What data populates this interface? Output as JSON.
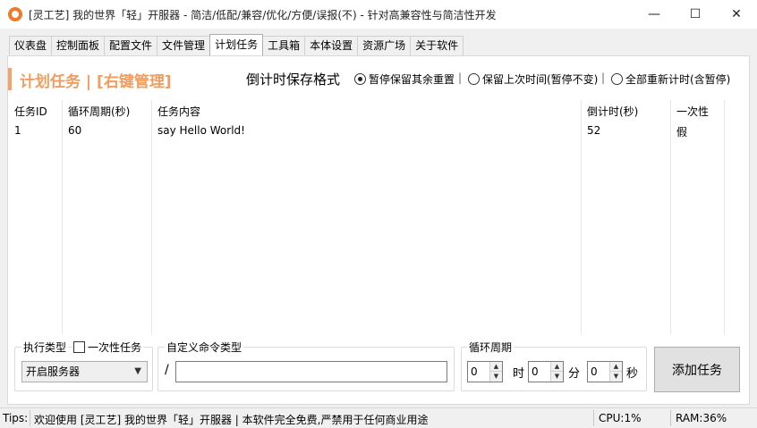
{
  "window": {
    "title": "[灵工艺] 我的世界「轻」开服器 - 简洁/低配/兼容/优化/方便/误报(不) - 针对高兼容性与简洁性开发",
    "minimize": "—",
    "maximize": "☐",
    "close": "✕"
  },
  "tabs": [
    {
      "label": "仪表盘"
    },
    {
      "label": "控制面板"
    },
    {
      "label": "配置文件"
    },
    {
      "label": "文件管理"
    },
    {
      "label": "计划任务",
      "active": true
    },
    {
      "label": "工具箱"
    },
    {
      "label": "本体设置"
    },
    {
      "label": "资源广场"
    },
    {
      "label": "关于软件"
    }
  ],
  "section": {
    "title": "计划任务 | [右键管理]",
    "countdown_format_label": "倒计时保存格式",
    "options": [
      {
        "label": "暂停保留其余重置",
        "checked": true
      },
      {
        "label": "保留上次时间(暂停不变)",
        "checked": false
      },
      {
        "label": "全部重新计时(含暂停)",
        "checked": false
      }
    ],
    "separator": "|"
  },
  "table": {
    "headers": [
      "任务ID",
      "循环周期(秒)",
      "任务内容",
      "倒计时(秒)",
      "一次性"
    ],
    "rows": [
      [
        "1",
        "60",
        "say Hello World!",
        "52",
        "假"
      ]
    ]
  },
  "form": {
    "exec_type_label": "执行类型",
    "once_checkbox_label": "一次性任务",
    "exec_type_value": "开启服务器",
    "custom_cmd_label": "自定义命令类型",
    "slash": "/",
    "custom_cmd_value": "",
    "cycle_label": "循环周期",
    "hours": "0",
    "hours_unit": "时",
    "minutes": "0",
    "minutes_unit": "分",
    "seconds": "0",
    "seconds_unit": "秒",
    "add_button": "添加任务"
  },
  "status": {
    "tips_label": "Tips:",
    "tips_text": "欢迎使用 [灵工艺] 我的世界「轻」开服器 | 本软件完全免费,严禁用于任何商业用途",
    "cpu": "CPU:1%",
    "ram": "RAM:36%"
  },
  "colors": {
    "accent": "#f29d5f",
    "accent_bar": "#f4a36b",
    "app_icon": "#ee7a2a"
  }
}
